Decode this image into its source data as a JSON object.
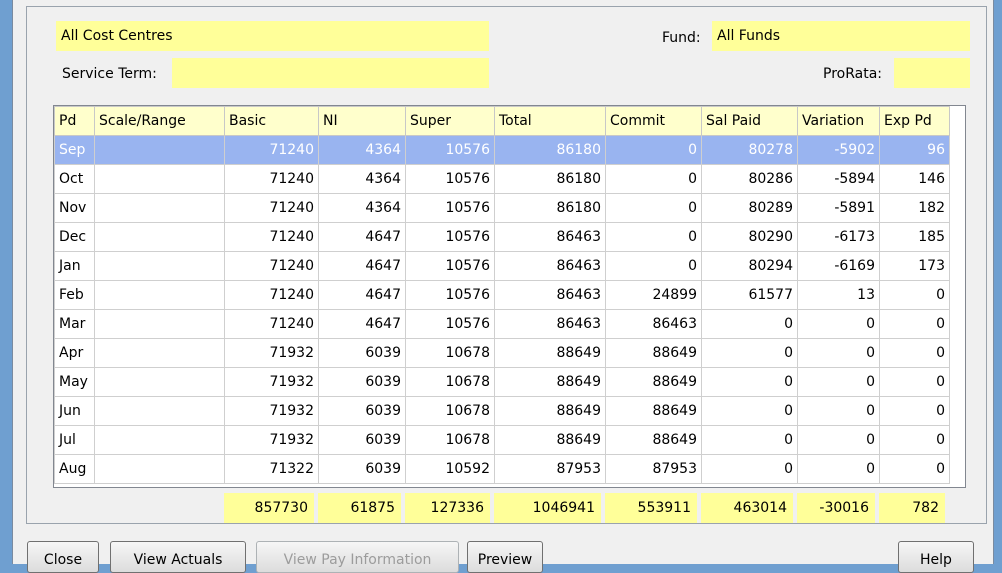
{
  "filters": {
    "cost_centre": "All Cost Centres",
    "fund_label": "Fund:",
    "fund_value": "All Funds",
    "service_term_label": "Service Term:",
    "service_term_value": "",
    "prorata_label": "ProRata:",
    "prorata_value": ""
  },
  "table": {
    "columns": [
      "Pd",
      "Scale/Range",
      "Basic",
      "NI",
      "Super",
      "Total",
      "Commit",
      "Sal Paid",
      "Variation",
      "Exp Pd"
    ],
    "rows": [
      [
        "Sep",
        "",
        "71240",
        "4364",
        "10576",
        "86180",
        "0",
        "80278",
        "-5902",
        "96"
      ],
      [
        "Oct",
        "",
        "71240",
        "4364",
        "10576",
        "86180",
        "0",
        "80286",
        "-5894",
        "146"
      ],
      [
        "Nov",
        "",
        "71240",
        "4364",
        "10576",
        "86180",
        "0",
        "80289",
        "-5891",
        "182"
      ],
      [
        "Dec",
        "",
        "71240",
        "4647",
        "10576",
        "86463",
        "0",
        "80290",
        "-6173",
        "185"
      ],
      [
        "Jan",
        "",
        "71240",
        "4647",
        "10576",
        "86463",
        "0",
        "80294",
        "-6169",
        "173"
      ],
      [
        "Feb",
        "",
        "71240",
        "4647",
        "10576",
        "86463",
        "24899",
        "61577",
        "13",
        "0"
      ],
      [
        "Mar",
        "",
        "71240",
        "4647",
        "10576",
        "86463",
        "86463",
        "0",
        "0",
        "0"
      ],
      [
        "Apr",
        "",
        "71932",
        "6039",
        "10678",
        "88649",
        "88649",
        "0",
        "0",
        "0"
      ],
      [
        "May",
        "",
        "71932",
        "6039",
        "10678",
        "88649",
        "88649",
        "0",
        "0",
        "0"
      ],
      [
        "Jun",
        "",
        "71932",
        "6039",
        "10678",
        "88649",
        "88649",
        "0",
        "0",
        "0"
      ],
      [
        "Jul",
        "",
        "71932",
        "6039",
        "10678",
        "88649",
        "88649",
        "0",
        "0",
        "0"
      ],
      [
        "Aug",
        "",
        "71322",
        "6039",
        "10592",
        "87953",
        "87953",
        "0",
        "0",
        "0"
      ]
    ],
    "selected_row": 0
  },
  "totals": [
    "857730",
    "61875",
    "127336",
    "1046941",
    "553911",
    "463014",
    "-30016",
    "782"
  ],
  "buttons": {
    "close": "Close",
    "view_actuals": "View Actuals",
    "view_pay_information": "View Pay Information",
    "preview": "Preview",
    "help": "Help"
  }
}
